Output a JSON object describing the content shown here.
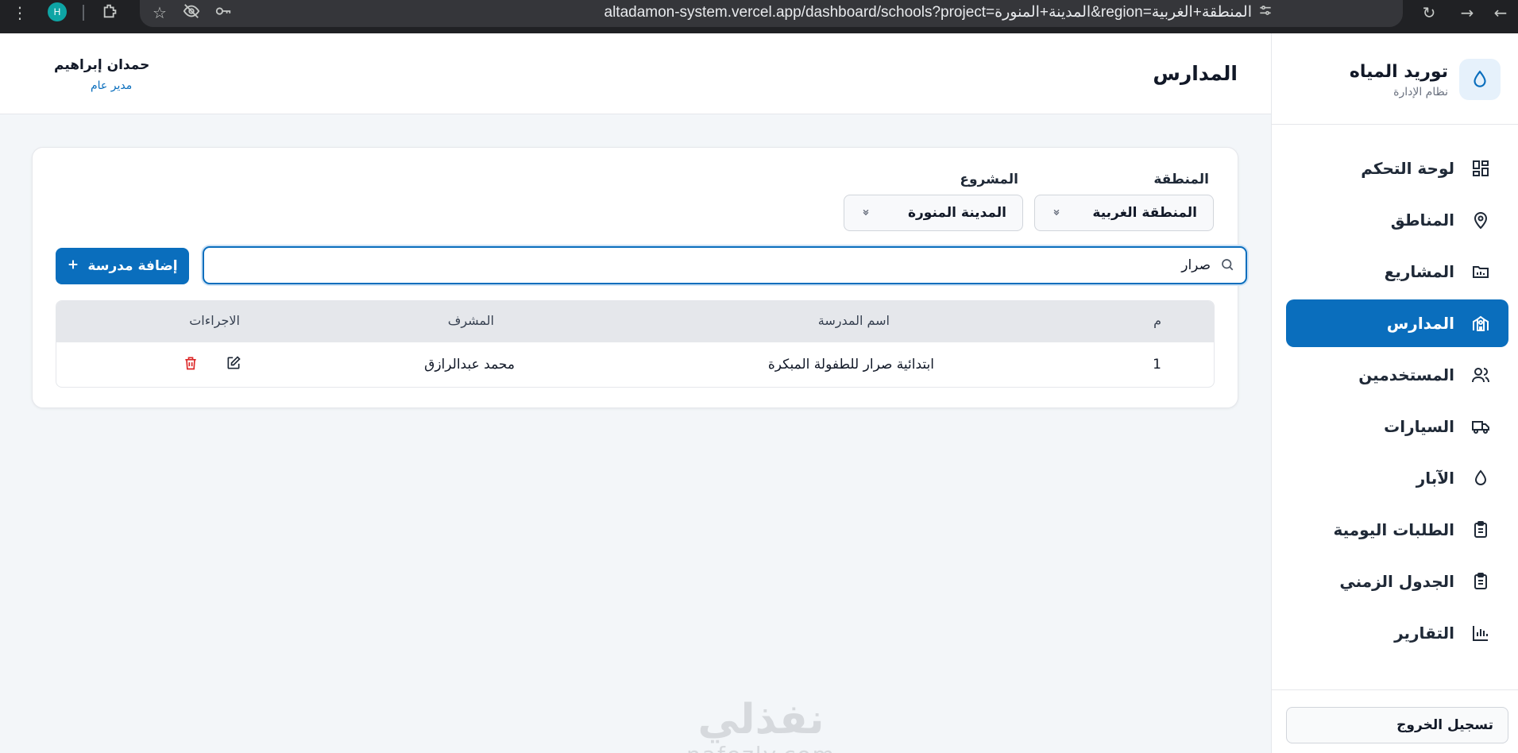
{
  "browser": {
    "url": "altadamon-system.vercel.app/dashboard/schools?project=المدينة+المنورة&region=المنطقة+الغربية",
    "profile_initial": "H"
  },
  "sidebar": {
    "brand_title": "توريد المياه",
    "brand_subtitle": "نظام الإدارة",
    "items": [
      {
        "label": "لوحة التحكم",
        "icon": "dashboard-grid-icon"
      },
      {
        "label": "المناطق",
        "icon": "map-pin-icon"
      },
      {
        "label": "المشاريع",
        "icon": "folder-icon"
      },
      {
        "label": "المدارس",
        "icon": "school-building-icon",
        "active": true
      },
      {
        "label": "المستخدمين",
        "icon": "users-icon"
      },
      {
        "label": "السيارات",
        "icon": "truck-icon"
      },
      {
        "label": "الآبار",
        "icon": "droplet-icon"
      },
      {
        "label": "الطلبات اليومية",
        "icon": "clipboard-list-icon"
      },
      {
        "label": "الجدول الزمني",
        "icon": "clipboard-list-icon"
      },
      {
        "label": "التقارير",
        "icon": "bar-chart-icon"
      }
    ],
    "logout_label": "تسجيل الخروج"
  },
  "header": {
    "page_title": "المدارس",
    "user_name": "حمدان إبراهيم",
    "user_role": "مدير عام"
  },
  "filters": {
    "region_label": "المنطقة",
    "region_value": "المنطقة الغربية",
    "project_label": "المشروع",
    "project_value": "المدينة المنورة"
  },
  "search": {
    "value": "صرار"
  },
  "add_button_label": "إضافة مدرسة",
  "table": {
    "columns": [
      "م",
      "اسم المدرسة",
      "المشرف",
      "الاجراءات"
    ],
    "rows": [
      {
        "index": "1",
        "school_name": "ابتدائية صرار للطفولة المبكرة",
        "supervisor": "محمد عبدالرازق"
      }
    ]
  },
  "watermark": {
    "arabic": "نفذلي",
    "latin": "nafezly.com"
  },
  "colors": {
    "primary": "#0a6ebd",
    "danger": "#dc2626",
    "sidebar_bg": "#ffffff",
    "page_bg": "#f3f6f9"
  }
}
